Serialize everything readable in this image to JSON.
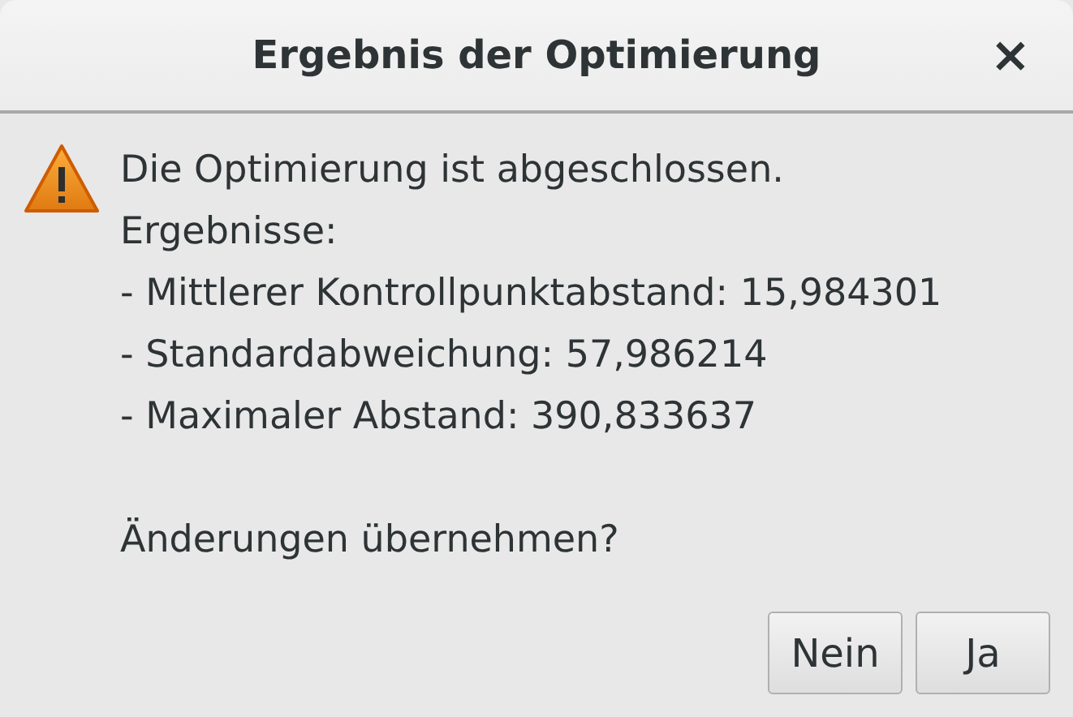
{
  "window": {
    "title": "Ergebnis der Optimierung",
    "close": "×"
  },
  "message_lines": [
    "Die Optimierung ist abgeschlossen.",
    "Ergebnisse:",
    "- Mittlerer Kontrollpunktabstand: 15,984301",
    "- Standardabweichung: 57,986214",
    "- Maximaler Abstand: 390,833637"
  ],
  "question": "Änderungen übernehmen?",
  "buttons": [
    "Nein",
    "Ja"
  ]
}
